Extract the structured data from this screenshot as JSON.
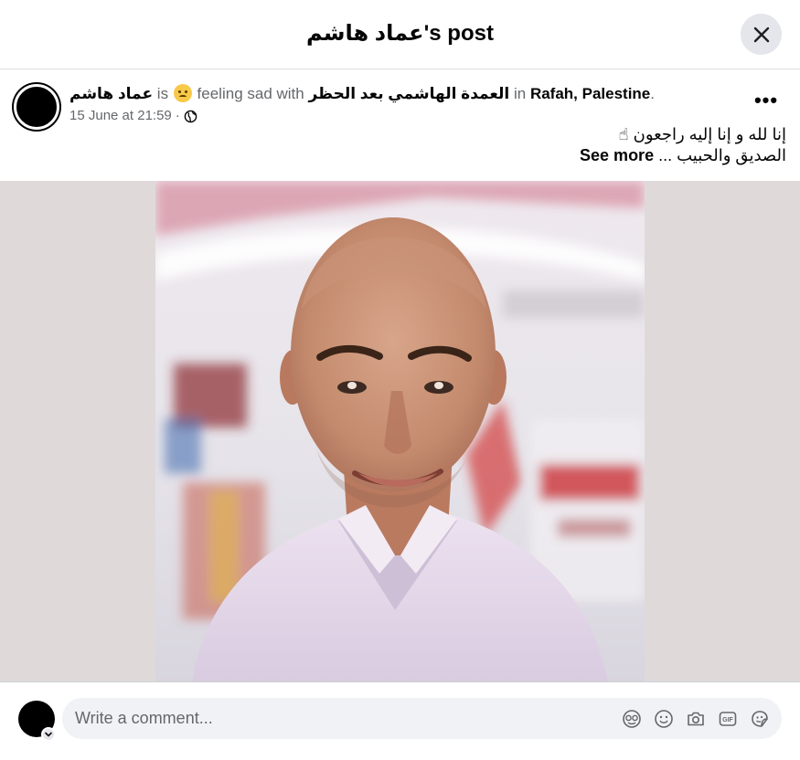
{
  "header": {
    "title": "عماد هاشم's post"
  },
  "post": {
    "author": "عماد هاشم",
    "is_text": "is",
    "feeling_text": "feeling sad with",
    "tagged": "العمدة الهاشمي بعد الحظر",
    "in_text": "in",
    "location": "Rafah, Palestine",
    "period": ".",
    "timestamp": "15 June at 21:59",
    "separator": "·",
    "text_line1": "إنا لله و إنا إليه راجعون ☝",
    "text_line2": "الصديق والحبيب ...",
    "see_more": "See more",
    "privacy_icon": "globe-icon",
    "more_label": "•••"
  },
  "comment": {
    "placeholder": "Write a comment...",
    "icons": [
      "avatar-sticker-icon",
      "emoji-icon",
      "camera-icon",
      "gif-icon",
      "sticker-icon"
    ]
  },
  "colors": {
    "text_primary": "#050505",
    "text_secondary": "#65676b",
    "close_bg": "#e4e6eb",
    "input_bg": "#f0f2f5",
    "photo_bg": "#dfd9da"
  }
}
